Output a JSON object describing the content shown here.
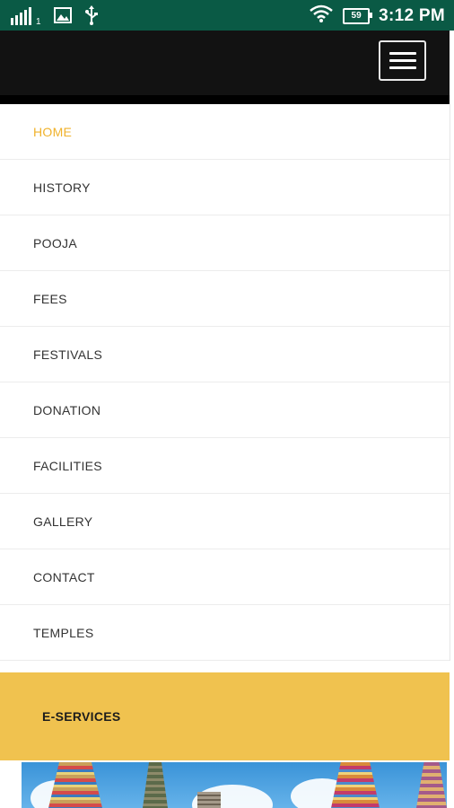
{
  "status_bar": {
    "signal_sim": "1",
    "battery_level": "59",
    "time": "3:12 PM"
  },
  "menu": {
    "items": [
      {
        "label": "HOME",
        "active": true
      },
      {
        "label": "HISTORY"
      },
      {
        "label": "POOJA"
      },
      {
        "label": "FEES"
      },
      {
        "label": "FESTIVALS"
      },
      {
        "label": "DONATION"
      },
      {
        "label": "FACILITIES"
      },
      {
        "label": "GALLERY"
      },
      {
        "label": "CONTACT"
      },
      {
        "label": "TEMPLES"
      }
    ],
    "eservices_label": "E-SERVICES"
  },
  "colors": {
    "status_bar_bg": "#0a5a45",
    "navbar_bg": "#121212",
    "active_item": "#f0b22b",
    "eservices_bg": "#f0c24f"
  },
  "icons": [
    "signal-icon",
    "image-icon",
    "usb-icon",
    "wifi-icon",
    "battery-icon",
    "hamburger-menu-icon"
  ]
}
